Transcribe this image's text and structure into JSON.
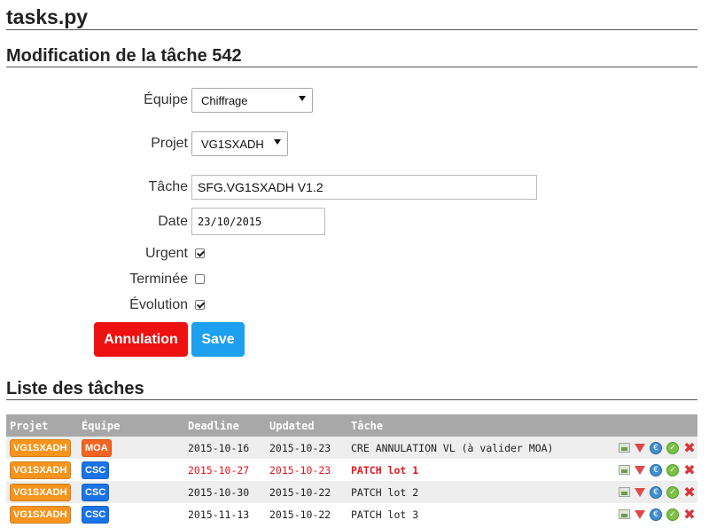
{
  "page_title": "tasks.py",
  "form": {
    "heading": "Modification de la tâche 542",
    "equipe": {
      "label": "Équipe",
      "value": "Chiffrage"
    },
    "projet": {
      "label": "Projet",
      "value": "VG1SXADH"
    },
    "tache": {
      "label": "Tâche",
      "value": "SFG.VG1SXADH V1.2"
    },
    "date": {
      "label": "Date",
      "value": "23/10/2015"
    },
    "urgent": {
      "label": "Urgent",
      "checked": true
    },
    "terminee": {
      "label": "Terminée",
      "checked": false
    },
    "evolution": {
      "label": "Évolution",
      "checked": true
    },
    "cancel_label": "Annulation",
    "save_label": "Save"
  },
  "list": {
    "heading": "Liste des tâches",
    "columns": [
      "Projet",
      "Équipe",
      "Deadline",
      "Updated",
      "Tâche"
    ],
    "rows": [
      {
        "projet": "VG1SXADH",
        "equipe": "MOA",
        "deadline": "2015-10-16",
        "updated": "2015-10-23",
        "tache": "CRE ANNULATION VL (à valider MOA)",
        "urgent": false
      },
      {
        "projet": "VG1SXADH",
        "equipe": "CSC",
        "deadline": "2015-10-27",
        "updated": "2015-10-23",
        "tache": "PATCH lot 1",
        "urgent": true
      },
      {
        "projet": "VG1SXADH",
        "equipe": "CSC",
        "deadline": "2015-10-30",
        "updated": "2015-10-22",
        "tache": "PATCH lot 2",
        "urgent": false
      },
      {
        "projet": "VG1SXADH",
        "equipe": "CSC",
        "deadline": "2015-11-13",
        "updated": "2015-10-22",
        "tache": "PATCH lot 3",
        "urgent": false
      }
    ],
    "row_icons": [
      "image-icon",
      "down-arrow-icon",
      "euro-icon",
      "check-icon",
      "delete-icon"
    ]
  },
  "colors": {
    "badge_projet": "#f7941d",
    "badge_moa": "#f26522",
    "badge_csc": "#1a73e8",
    "cancel_button": "#ee1111",
    "save_button": "#1ea0f0",
    "urgent_text": "#e8141b",
    "table_header": "#a8a8a8"
  }
}
